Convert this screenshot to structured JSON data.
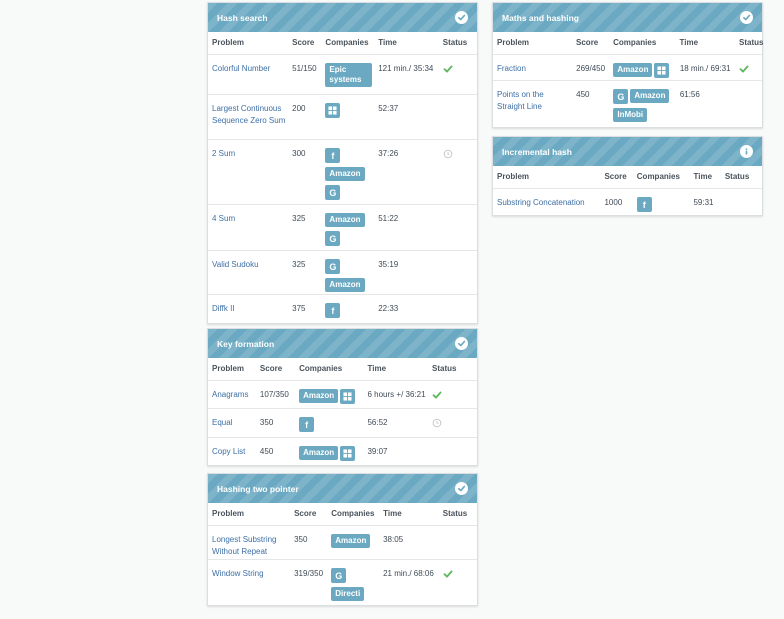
{
  "panels": [
    {
      "title": "Hash search",
      "icon": "check-circle-icon",
      "columns": [
        "Problem",
        "Score",
        "Companies",
        "Time",
        "Status"
      ],
      "rows": [
        {
          "problem": "Colorful Number",
          "score": "51/150",
          "companies": [
            "Epic systems"
          ],
          "time": "121 min./ 35:34",
          "status": "solved"
        },
        {
          "problem": "Largest Continuous Sequence Zero Sum",
          "score": "200",
          "companies": [
            "microsoft-icon"
          ],
          "time": "52:37",
          "status": ""
        },
        {
          "problem": "2 Sum",
          "score": "300",
          "companies": [
            "facebook-icon",
            "Amazon",
            "google-icon"
          ],
          "time": "37:26",
          "status": "attempted"
        },
        {
          "problem": "4 Sum",
          "score": "325",
          "companies": [
            "Amazon",
            "google-icon"
          ],
          "time": "51:22",
          "status": ""
        },
        {
          "problem": "Valid Sudoku",
          "score": "325",
          "companies": [
            "google-icon",
            "Amazon"
          ],
          "time": "35:19",
          "status": ""
        },
        {
          "problem": "Diffk II",
          "score": "375",
          "companies": [
            "facebook-icon"
          ],
          "time": "22:33",
          "status": ""
        }
      ]
    },
    {
      "title": "Key formation",
      "icon": "check-circle-icon",
      "columns": [
        "Problem",
        "Score",
        "Companies",
        "Time",
        "Status"
      ],
      "rows": [
        {
          "problem": "Anagrams",
          "score": "107/350",
          "companies": [
            "Amazon",
            "microsoft-icon"
          ],
          "time": "6 hours +/ 36:21",
          "status": "solved"
        },
        {
          "problem": "Equal",
          "score": "350",
          "companies": [
            "facebook-icon"
          ],
          "time": "56:52",
          "status": "attempted"
        },
        {
          "problem": "Copy List",
          "score": "450",
          "companies": [
            "Amazon",
            "microsoft-icon"
          ],
          "time": "39:07",
          "status": ""
        }
      ]
    },
    {
      "title": "Hashing two pointer",
      "icon": "check-circle-icon",
      "columns": [
        "Problem",
        "Score",
        "Companies",
        "Time",
        "Status"
      ],
      "rows": [
        {
          "problem": "Longest Substring Without Repeat",
          "score": "350",
          "companies": [
            "Amazon"
          ],
          "time": "38:05",
          "status": ""
        },
        {
          "problem": "Window String",
          "score": "319/350",
          "companies": [
            "google-icon",
            "Directi"
          ],
          "time": "21 min./ 68:06",
          "status": "solved"
        }
      ]
    },
    {
      "title": "Maths and hashing",
      "icon": "check-circle-icon",
      "columns": [
        "Problem",
        "Score",
        "Companies",
        "Time",
        "Status"
      ],
      "rows": [
        {
          "problem": "Fraction",
          "score": "269/450",
          "companies": [
            "Amazon",
            "microsoft-icon"
          ],
          "time": "18 min./ 69:31",
          "status": "solved"
        },
        {
          "problem": "Points on the Straight Line",
          "score": "450",
          "companies": [
            "google-icon",
            "Amazon",
            "InMobi"
          ],
          "time": "61:56",
          "status": ""
        }
      ]
    },
    {
      "title": "Incremental hash",
      "icon": "info-circle-icon",
      "columns": [
        "Problem",
        "Score",
        "Companies",
        "Time",
        "Status"
      ],
      "rows": [
        {
          "problem": "Substring Concatenation",
          "score": "1000",
          "companies": [
            "facebook-icon"
          ],
          "time": "59:31",
          "status": ""
        }
      ]
    }
  ],
  "colors": {
    "header": "#6aa9c1",
    "link": "#3d6fa5",
    "solved": "#5cb85c",
    "attempted": "#c8c8c8"
  }
}
